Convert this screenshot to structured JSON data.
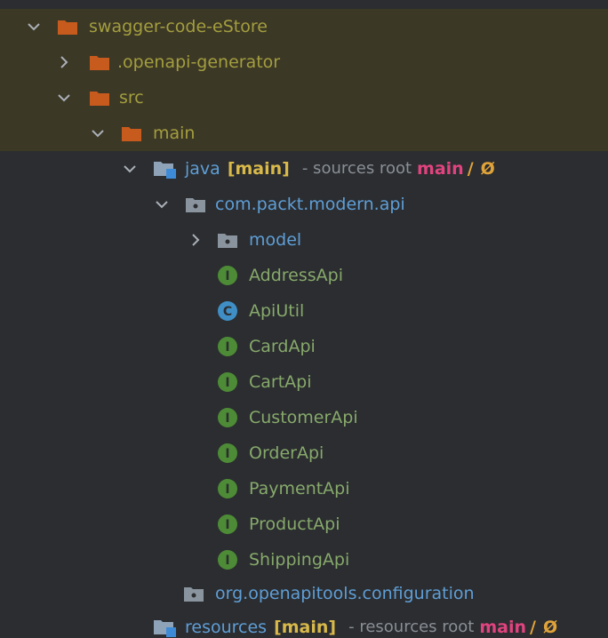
{
  "tree": {
    "root": {
      "label": "swagger-code-eStore"
    },
    "openapi_generator": {
      "label": ".openapi-generator"
    },
    "src": {
      "label": "src"
    },
    "main": {
      "label": "main"
    },
    "java": {
      "label": "java",
      "source_set": "[main]",
      "root_tag": "- sources root",
      "module": "main",
      "separator": "/",
      "null_symbol": "Ø"
    },
    "package_api": {
      "label": "com.packt.modern.api"
    },
    "package_model": {
      "label": "model"
    },
    "classes": [
      {
        "label": "AddressApi",
        "kind": "interface",
        "badge": "I"
      },
      {
        "label": "ApiUtil",
        "kind": "class",
        "badge": "C"
      },
      {
        "label": "CardApi",
        "kind": "interface",
        "badge": "I"
      },
      {
        "label": "CartApi",
        "kind": "interface",
        "badge": "I"
      },
      {
        "label": "CustomerApi",
        "kind": "interface",
        "badge": "I"
      },
      {
        "label": "OrderApi",
        "kind": "interface",
        "badge": "I"
      },
      {
        "label": "PaymentApi",
        "kind": "interface",
        "badge": "I"
      },
      {
        "label": "ProductApi",
        "kind": "interface",
        "badge": "I"
      },
      {
        "label": "ShippingApi",
        "kind": "interface",
        "badge": "I"
      }
    ],
    "package_config": {
      "label": "org.openapitools.configuration"
    },
    "resources": {
      "label": "resources",
      "source_set": "[main]",
      "root_tag": "- resources root",
      "module": "main",
      "separator": "/",
      "null_symbol": "Ø"
    }
  },
  "colors": {
    "background": "#2b2d30",
    "excluded_row": "#3c3826",
    "folder_orange": "#c75a1d",
    "interface_badge": "#4d8b36",
    "class_badge": "#3f8fc6",
    "excluded_text": "#a39e3e",
    "source_text": "#5f9ed6"
  }
}
